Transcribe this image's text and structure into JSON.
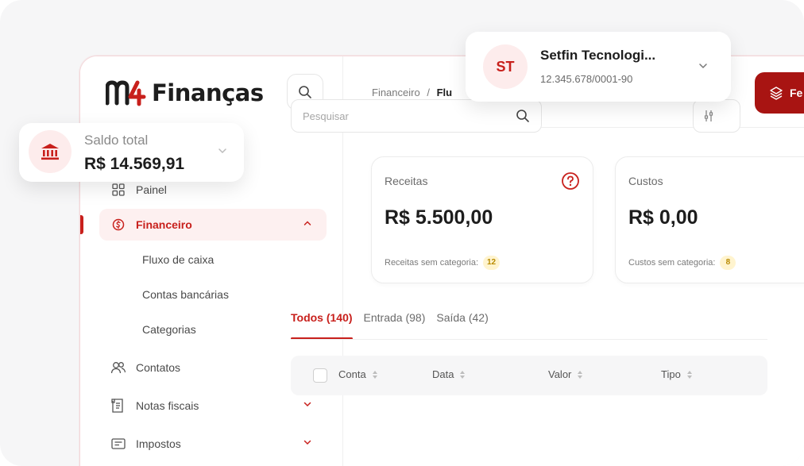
{
  "brand": {
    "name": "Finanças",
    "mark": "M4",
    "accent": "#c8201c",
    "dark_accent": "#a81412"
  },
  "company": {
    "initials": "ST",
    "name": "Setfin Tecnologi...",
    "document": "12.345.678/0001-90"
  },
  "balance": {
    "label": "Saldo total",
    "value": "R$ 14.569,91"
  },
  "sidebar": {
    "items": [
      {
        "label": "Painel",
        "icon": "grid-icon"
      },
      {
        "label": "Financeiro",
        "icon": "finance-icon",
        "active": true
      },
      {
        "label": "Contatos",
        "icon": "users-icon"
      },
      {
        "label": "Notas fiscais",
        "icon": "invoice-icon"
      },
      {
        "label": "Impostos",
        "icon": "tax-icon"
      }
    ],
    "subitems": [
      "Fluxo de caixa",
      "Contas bancárias",
      "Categorias"
    ]
  },
  "header": {
    "breadcrumb_root": "Financeiro",
    "breadcrumb_sep": "/",
    "breadcrumb_current": "Flu",
    "action_label": "Fe"
  },
  "search": {
    "placeholder": "Pesquisar"
  },
  "filter": {
    "label": "Ift"
  },
  "cards": [
    {
      "title": "Receitas",
      "value": "R$ 5.500,00",
      "note": "Receitas sem categoria:",
      "badge": "12"
    },
    {
      "title": "Custos",
      "value": "R$ 0,00",
      "note": "Custos sem categoria:",
      "badge": "8"
    }
  ],
  "tabs": [
    {
      "label": "Todos (140)",
      "active": true
    },
    {
      "label": "Entrada (98)"
    },
    {
      "label": "Saída (42)"
    }
  ],
  "table": {
    "columns": [
      "Conta",
      "Data",
      "Valor",
      "Tipo"
    ]
  }
}
